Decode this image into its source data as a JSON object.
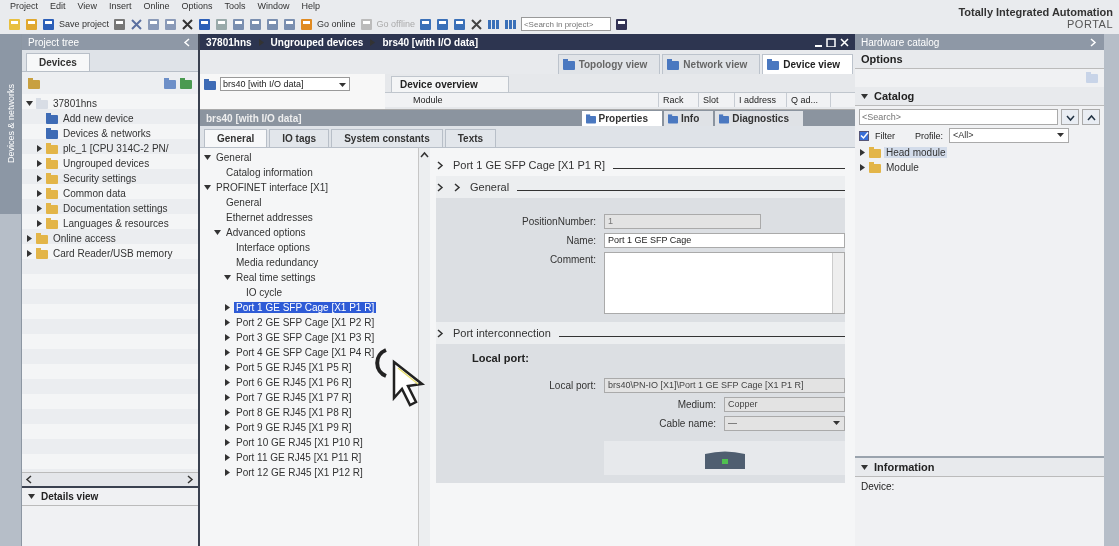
{
  "menu": [
    "Project",
    "Edit",
    "View",
    "Insert",
    "Online",
    "Options",
    "Tools",
    "Window",
    "Help"
  ],
  "brand": {
    "title": "Totally Integrated Automation",
    "subtitle": "PORTAL"
  },
  "toolbar": {
    "save": "Save project",
    "go_online": "Go online",
    "go_offline": {
      "label": "Go offline",
      "disabled": true
    },
    "search_placeholder": "<Search in project>"
  },
  "side_strip": {
    "label": "Devices & networks"
  },
  "project_tree": {
    "title": "Project tree",
    "tab": "Devices",
    "items": [
      {
        "label": "37801hns",
        "kind": "group",
        "expanded": true,
        "children": [
          {
            "label": "Add new device",
            "kind": "leaf"
          },
          {
            "label": "Devices & networks",
            "kind": "leaf"
          },
          {
            "label": "plc_1 [CPU 314C-2 PN/",
            "kind": "group",
            "expanded": false
          },
          {
            "label": "Ungrouped devices",
            "kind": "group",
            "expanded": false
          },
          {
            "label": "Security settings",
            "kind": "group",
            "expanded": false
          },
          {
            "label": "Common data",
            "kind": "group",
            "expanded": false
          },
          {
            "label": "Documentation settings",
            "kind": "group",
            "expanded": false
          },
          {
            "label": "Languages & resources",
            "kind": "group",
            "expanded": false
          }
        ]
      },
      {
        "label": "Online access",
        "kind": "group",
        "expanded": false
      },
      {
        "label": "Card Reader/USB memory",
        "kind": "group",
        "expanded": false
      }
    ],
    "details": "Details view"
  },
  "editor": {
    "breadcrumb": [
      "37801hns",
      "Ungrouped devices",
      "brs40 [with I/O data]"
    ],
    "view_tabs": [
      {
        "label": "Topology view",
        "selected": false
      },
      {
        "label": "Network view",
        "selected": false
      },
      {
        "label": "Device view",
        "selected": true
      }
    ],
    "device_select": "brs40 [with I/O data]",
    "overview": {
      "tab": "Device overview",
      "columns": [
        "Module",
        "Rack",
        "Slot",
        "I address",
        "Q ad..."
      ]
    }
  },
  "properties": {
    "title": "brs40 [with I/O data]",
    "tabs": [
      {
        "label": "Properties",
        "selected": true
      },
      {
        "label": "Info",
        "selected": false
      },
      {
        "label": "Diagnostics",
        "selected": false
      }
    ],
    "subtabs": [
      {
        "label": "General",
        "selected": true
      },
      {
        "label": "IO tags",
        "selected": false
      },
      {
        "label": "System constants",
        "selected": false
      },
      {
        "label": "Texts",
        "selected": false
      }
    ],
    "nav": [
      {
        "label": "General",
        "expanded": true,
        "selected": false,
        "children": [
          {
            "label": "Catalog information",
            "selected": false
          }
        ]
      },
      {
        "label": "PROFINET interface [X1]",
        "expanded": true,
        "selected": false,
        "children": [
          {
            "label": "General",
            "selected": false
          },
          {
            "label": "Ethernet addresses",
            "selected": false
          },
          {
            "label": "Advanced options",
            "expanded": true,
            "selected": false,
            "children": [
              {
                "label": "Interface options",
                "selected": false
              },
              {
                "label": "Media redundancy",
                "selected": false
              },
              {
                "label": "Real time settings",
                "expanded": true,
                "selected": false,
                "children": [
                  {
                    "label": "IO cycle",
                    "selected": false
                  }
                ]
              },
              {
                "label": "Port 1 GE SFP Cage [X1 P1 R]",
                "expanded": false,
                "selected": true
              },
              {
                "label": "Port 2 GE SFP Cage [X1 P2 R]",
                "expanded": false,
                "selected": false
              },
              {
                "label": "Port 3 GE SFP Cage [X1 P3 R]",
                "expanded": false,
                "selected": false
              },
              {
                "label": "Port 4 GE SFP Cage [X1 P4 R]",
                "expanded": false,
                "selected": false
              },
              {
                "label": "Port 5 GE RJ45 [X1 P5 R]",
                "expanded": false,
                "selected": false
              },
              {
                "label": "Port 6 GE RJ45 [X1 P6 R]",
                "expanded": false,
                "selected": false
              },
              {
                "label": "Port 7 GE RJ45 [X1 P7 R]",
                "expanded": false,
                "selected": false
              },
              {
                "label": "Port 8 GE RJ45 [X1 P8 R]",
                "expanded": false,
                "selected": false
              },
              {
                "label": "Port 9 GE RJ45 [X1 P9 R]",
                "expanded": false,
                "selected": false
              },
              {
                "label": "Port 10 GE RJ45 [X1 P10 R]",
                "expanded": false,
                "selected": false
              },
              {
                "label": "Port 11 GE RJ45 [X1 P11 R]",
                "expanded": false,
                "selected": false
              },
              {
                "label": "Port 12 GE RJ45 [X1 P12 R]",
                "expanded": false,
                "selected": false
              }
            ]
          }
        ]
      }
    ],
    "section": "Port 1 GE SFP Cage [X1 P1 R]",
    "general": {
      "title": "General",
      "fields": [
        {
          "label": "PositionNumber:",
          "kind": "text",
          "value": "1",
          "disabled": true
        },
        {
          "label": "Name:",
          "kind": "text",
          "value": "Port 1 GE SFP Cage",
          "disabled": false
        },
        {
          "label": "Comment:",
          "kind": "textarea"
        }
      ]
    },
    "interconnection": {
      "title": "Port interconnection",
      "heading": "Local port:",
      "local_port": {
        "label": "Local port:",
        "value": "brs40\\PN-IO [X1]\\Port 1 GE SFP Cage [X1 P1 R]"
      },
      "fields": [
        {
          "label": "Medium:",
          "kind": "text",
          "value": "Copper"
        },
        {
          "label": "Cable name:",
          "kind": "select",
          "value": "—"
        }
      ]
    }
  },
  "catalog": {
    "title": "Hardware catalog",
    "options": "Options",
    "section": "Catalog",
    "search_placeholder": "<Search>",
    "filter": {
      "label": "Filter",
      "checked": true
    },
    "profile_label": "Profile:",
    "profile": "<All>",
    "items": [
      {
        "label": "Head module",
        "selected": true
      },
      {
        "label": "Module",
        "selected": false
      }
    ],
    "information": {
      "title": "Information",
      "device_label": "Device:"
    }
  }
}
